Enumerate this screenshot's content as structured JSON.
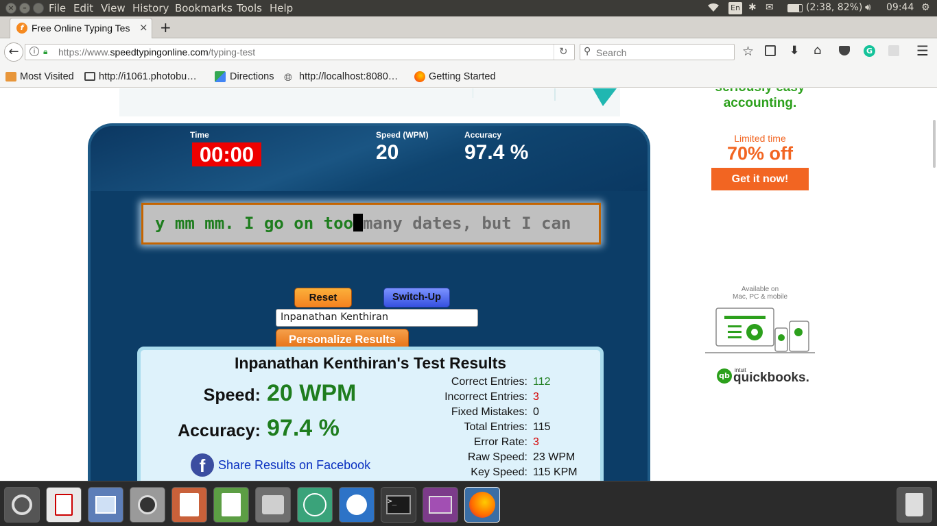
{
  "system": {
    "menu": [
      "File",
      "Edit",
      "View",
      "History",
      "Bookmarks",
      "Tools",
      "Help"
    ],
    "keyboard": "En",
    "battery": "(2:38, 82%)",
    "clock": "09:44"
  },
  "browser": {
    "tab_title": "Free Online Typing Tes",
    "url_domain_prefix": "https://www.",
    "url_domain": "speedtypingonline.com",
    "url_path": "/typing-test",
    "search_placeholder": "Search",
    "bookmarks": [
      "Most Visited",
      "http://i1061.photobu…",
      "Directions",
      "http://localhost:8080…",
      "Getting Started"
    ]
  },
  "test": {
    "time_label": "Time",
    "time_value": "00:00",
    "speed_label": "Speed (WPM)",
    "speed_value": "20",
    "accuracy_label": "Accuracy",
    "accuracy_value": "97.4 %",
    "typed_text": "y mm mm. I go on too",
    "remaining_text": "many dates, but I can",
    "reset_label": "Reset",
    "switchup_label": "Switch-Up",
    "name_value": "Inpanathan Kenthiran",
    "personalize_label": "Personalize Results"
  },
  "results": {
    "title": "Inpanathan Kenthiran's Test Results",
    "speed_label": "Speed:",
    "speed_value": "20 WPM",
    "accuracy_label": "Accuracy:",
    "accuracy_value": "97.4 %",
    "share_label": "Share Results on Facebook",
    "stats": [
      {
        "label": "Correct Entries:",
        "value": "112",
        "color": "green"
      },
      {
        "label": "Incorrect Entries:",
        "value": "3",
        "color": "red"
      },
      {
        "label": "Fixed Mistakes:",
        "value": "0",
        "color": "black"
      },
      {
        "label": "Total Entries:",
        "value": "115",
        "color": "black"
      },
      {
        "label": "Error Rate:",
        "value": "3",
        "color": "red"
      },
      {
        "label": "Raw Speed:",
        "value": "23 WPM",
        "color": "black"
      },
      {
        "label": "Key Speed:",
        "value": "115 KPM",
        "color": "black"
      }
    ]
  },
  "ad": {
    "line1": "seriously easy",
    "line2": "accounting.",
    "limited": "Limited time",
    "offer": "70% off",
    "cta": "Get it now!",
    "available": "Available on",
    "platforms": "Mac, PC & mobile",
    "brand_small": "intuit",
    "brand": "quickbooks."
  },
  "colors": {
    "panel": "#0c3d67",
    "timer": "#ee0000",
    "typed": "#1e7d1e",
    "ad_green": "#2ca01c",
    "ad_orange": "#f26522"
  }
}
